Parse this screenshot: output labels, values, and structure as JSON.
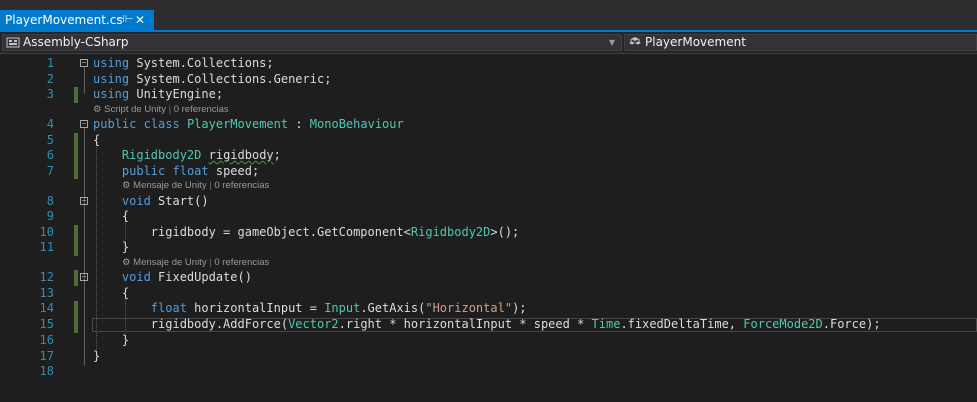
{
  "tab": {
    "title": "PlayerMovement.cs",
    "pin_icon": "pin-icon",
    "close_icon": "close-icon",
    "accent": "#007acc"
  },
  "navbar": {
    "project": "Assembly-CSharp",
    "project_icon": "project-icon",
    "class_name": "PlayerMovement",
    "class_icon": "class-icon"
  },
  "lenses": {
    "line3": {
      "label": "Script de Unity",
      "refs": "0 referencias"
    },
    "line7": {
      "label": "Mensaje de Unity",
      "refs": "0 referencias"
    },
    "line11": {
      "label": "Mensaje de Unity",
      "refs": "0 referencias"
    }
  },
  "lines": [
    {
      "n": "1",
      "text": "using System.Collections;"
    },
    {
      "n": "2",
      "text": "using System.Collections.Generic;"
    },
    {
      "n": "3",
      "text": "using UnityEngine;"
    },
    {
      "n": "4",
      "text": "public class PlayerMovement : MonoBehaviour"
    },
    {
      "n": "5",
      "text": "{"
    },
    {
      "n": "6",
      "text": "    Rigidbody2D rigidbody;"
    },
    {
      "n": "7",
      "text": "    public float speed;"
    },
    {
      "n": "8",
      "text": "    void Start()"
    },
    {
      "n": "9",
      "text": "    {"
    },
    {
      "n": "10",
      "text": "        rigidbody = gameObject.GetComponent<Rigidbody2D>();"
    },
    {
      "n": "11",
      "text": "    }"
    },
    {
      "n": "12",
      "text": "    void FixedUpdate()"
    },
    {
      "n": "13",
      "text": "    {"
    },
    {
      "n": "14",
      "text": "        float horizontalInput = Input.GetAxis(\"Horizontal\");"
    },
    {
      "n": "15",
      "text": "        rigidbody.AddForce(Vector2.right * horizontalInput * speed * Time.fixedDeltaTime, ForceMode2D.Force);"
    },
    {
      "n": "16",
      "text": "    }"
    },
    {
      "n": "17",
      "text": "}"
    },
    {
      "n": "18",
      "text": ""
    }
  ]
}
